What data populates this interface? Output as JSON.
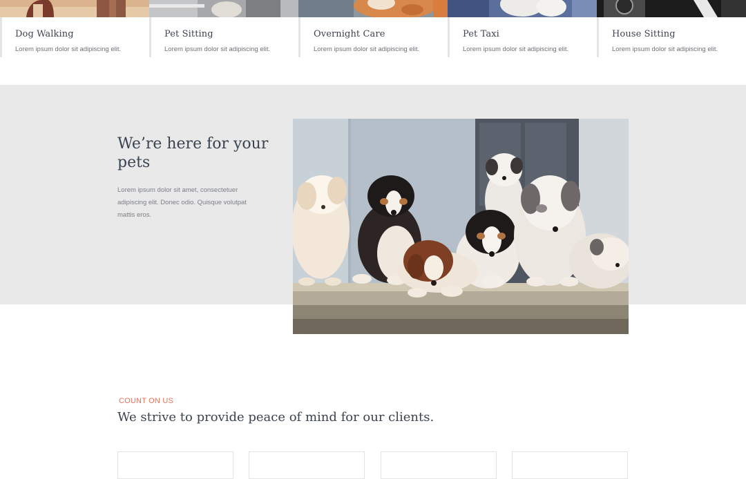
{
  "services": [
    {
      "title": "Dog Walking",
      "desc": "Lorem ipsum dolor sit adipiscing elit.",
      "image": "dog-walking-photo"
    },
    {
      "title": "Pet Sitting",
      "desc": "Lorem ipsum dolor sit adipiscing elit.",
      "image": "pet-sitting-photo"
    },
    {
      "title": "Overnight Care",
      "desc": "Lorem ipsum dolor sit adipiscing elit.",
      "image": "overnight-care-photo"
    },
    {
      "title": "Pet Taxi",
      "desc": "Lorem ipsum dolor sit adipiscing elit.",
      "image": "pet-taxi-photo"
    },
    {
      "title": "House Sitting",
      "desc": "Lorem ipsum dolor sit adipiscing elit.",
      "image": "house-sitting-photo"
    }
  ],
  "here": {
    "heading": "We’re here for your pets",
    "text": "Lorem ipsum dolor sit amet, consectetuer adipiscing elit. Donec odio. Quisque volutpat mattis eros.",
    "image": "puppies-photo"
  },
  "count": {
    "eyebrow": "COUNT ON US",
    "heading": "We strive to provide peace of mind for our clients."
  },
  "colors": {
    "accent": "#e6705a",
    "band": "#e9e9e9",
    "heading": "#3a4350"
  }
}
